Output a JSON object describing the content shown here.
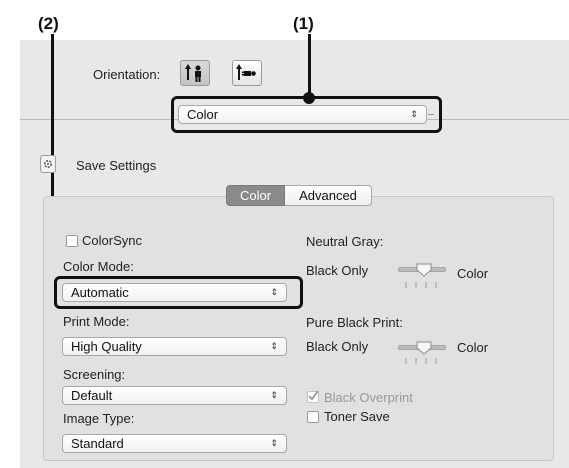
{
  "callouts": {
    "one": "(1)",
    "two": "(2)"
  },
  "orientation": {
    "label": "Orientation:"
  },
  "panel_select": {
    "value": "Color"
  },
  "save_settings": {
    "label": "Save Settings"
  },
  "tabs": [
    {
      "label": "Color",
      "selected": true
    },
    {
      "label": "Advanced",
      "selected": false
    }
  ],
  "colorsync": {
    "label": "ColorSync",
    "checked": false
  },
  "color_mode": {
    "label": "Color Mode:",
    "value": "Automatic"
  },
  "print_mode": {
    "label": "Print Mode:",
    "value": "High Quality"
  },
  "screening": {
    "label": "Screening:",
    "value": "Default"
  },
  "image_type": {
    "label": "Image Type:",
    "value": "Standard"
  },
  "neutral_gray": {
    "label": "Neutral Gray:",
    "left": "Black Only",
    "right": "Color"
  },
  "pure_black_print": {
    "label": "Pure Black Print:",
    "left": "Black Only",
    "right": "Color"
  },
  "black_overprint": {
    "label": "Black Overprint",
    "checked": true,
    "enabled": false
  },
  "toner_save": {
    "label": "Toner Save",
    "checked": false
  },
  "select_arrow": "⇕",
  "colors": {
    "highlight": "#111111",
    "selected_tab": "#8a8a8a"
  }
}
